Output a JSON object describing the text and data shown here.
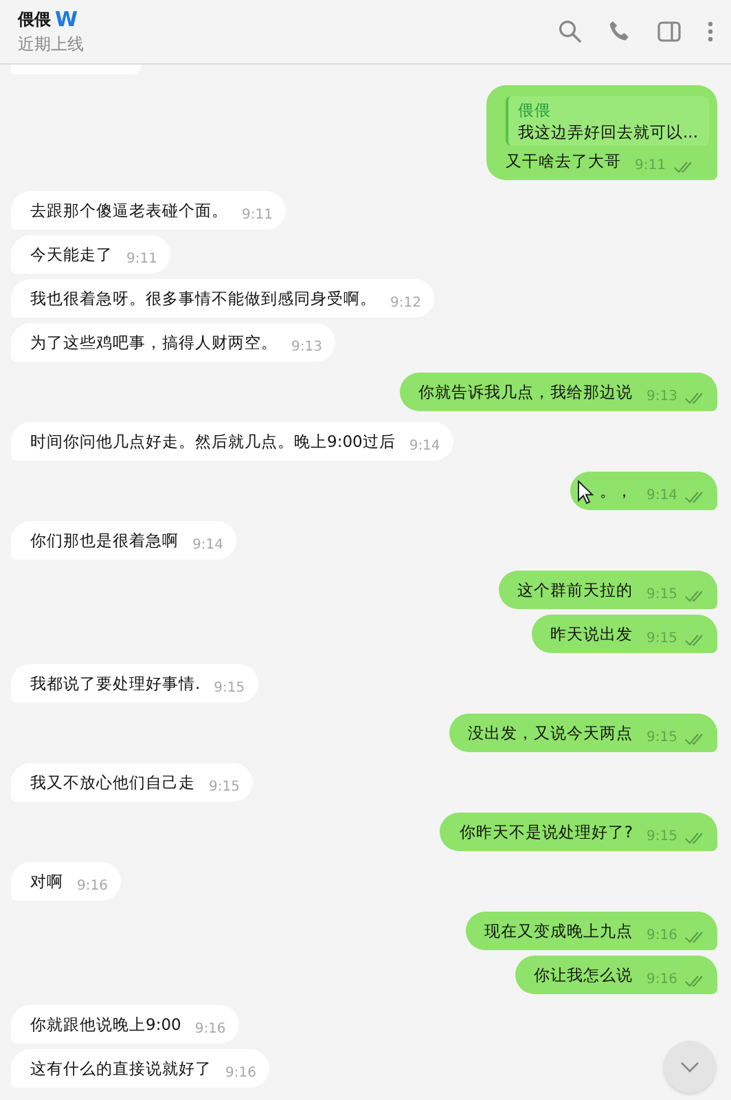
{
  "header": {
    "name": "偎偎",
    "badge": "W",
    "status": "近期上线"
  },
  "messages": [
    {
      "kind": "partial"
    },
    {
      "kind": "out",
      "quote": {
        "author": "偎偎",
        "text": "我这边弄好回去就可以..."
      },
      "text": "又干啥去了大哥",
      "time": "9:11",
      "read": true
    },
    {
      "kind": "in",
      "text": "去跟那个傻逼老表碰个面。",
      "time": "9:11"
    },
    {
      "kind": "in",
      "text": "今天能走了",
      "time": "9:11"
    },
    {
      "kind": "in",
      "text": "我也很着急呀。很多事情不能做到感同身受啊。",
      "time": "9:12"
    },
    {
      "kind": "in",
      "text": "为了这些鸡吧事，搞得人财两空。",
      "time": "9:13"
    },
    {
      "kind": "out",
      "text": "你就告诉我几点，我给那边说",
      "time": "9:13",
      "read": true
    },
    {
      "kind": "in",
      "text": "时间你问他几点好走。然后就几点。晚上9:00过后",
      "time": "9:14"
    },
    {
      "kind": "out",
      "text": "。，",
      "time": "9:14",
      "read": true,
      "cursor": true
    },
    {
      "kind": "in",
      "text": "你们那也是很着急啊",
      "time": "9:14"
    },
    {
      "kind": "out",
      "text": "这个群前天拉的",
      "time": "9:15",
      "read": true
    },
    {
      "kind": "out",
      "text": "昨天说出发",
      "time": "9:15",
      "read": true
    },
    {
      "kind": "in",
      "text": "我都说了要处理好事情.",
      "time": "9:15"
    },
    {
      "kind": "out",
      "text": "没出发，又说今天两点",
      "time": "9:15",
      "read": true
    },
    {
      "kind": "in",
      "text": "我又不放心他们自己走",
      "time": "9:15"
    },
    {
      "kind": "out",
      "text": "你昨天不是说处理好了?",
      "time": "9:15",
      "read": true
    },
    {
      "kind": "in",
      "text": "对啊",
      "time": "9:16"
    },
    {
      "kind": "out",
      "text": "现在又变成晚上九点",
      "time": "9:16",
      "read": true
    },
    {
      "kind": "out",
      "text": "你让我怎么说",
      "time": "9:16",
      "read": true
    },
    {
      "kind": "in",
      "text": "你就跟他说晚上9:00",
      "time": "9:16"
    },
    {
      "kind": "in",
      "text": "这有什么的直接说就好了",
      "time": "9:16"
    }
  ]
}
